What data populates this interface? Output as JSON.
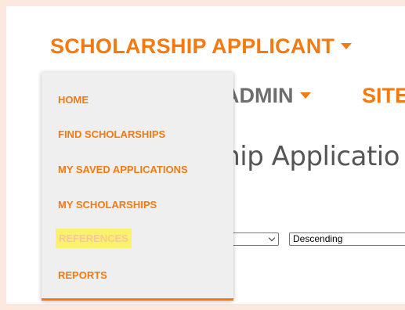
{
  "nav": {
    "applicant_label": "SCHOLARSHIP APPLICANT",
    "admin_label": "ADMIN",
    "site_label": "SITE"
  },
  "page": {
    "title": "ship Applicatio"
  },
  "filters": {
    "sort_field_value": "",
    "sort_order_value": "Descending"
  },
  "menu": {
    "items": [
      {
        "label": "HOME"
      },
      {
        "label": "FIND SCHOLARSHIPS"
      },
      {
        "label": "MY SAVED APPLICATIONS"
      },
      {
        "label": "MY SCHOLARSHIPS"
      },
      {
        "label": "REFERENCES",
        "highlighted": true
      },
      {
        "label": "REPORTS"
      }
    ]
  },
  "colors": {
    "accent": "#f47a0f",
    "highlight": "#faf36a",
    "menu_bg": "#efefef"
  }
}
